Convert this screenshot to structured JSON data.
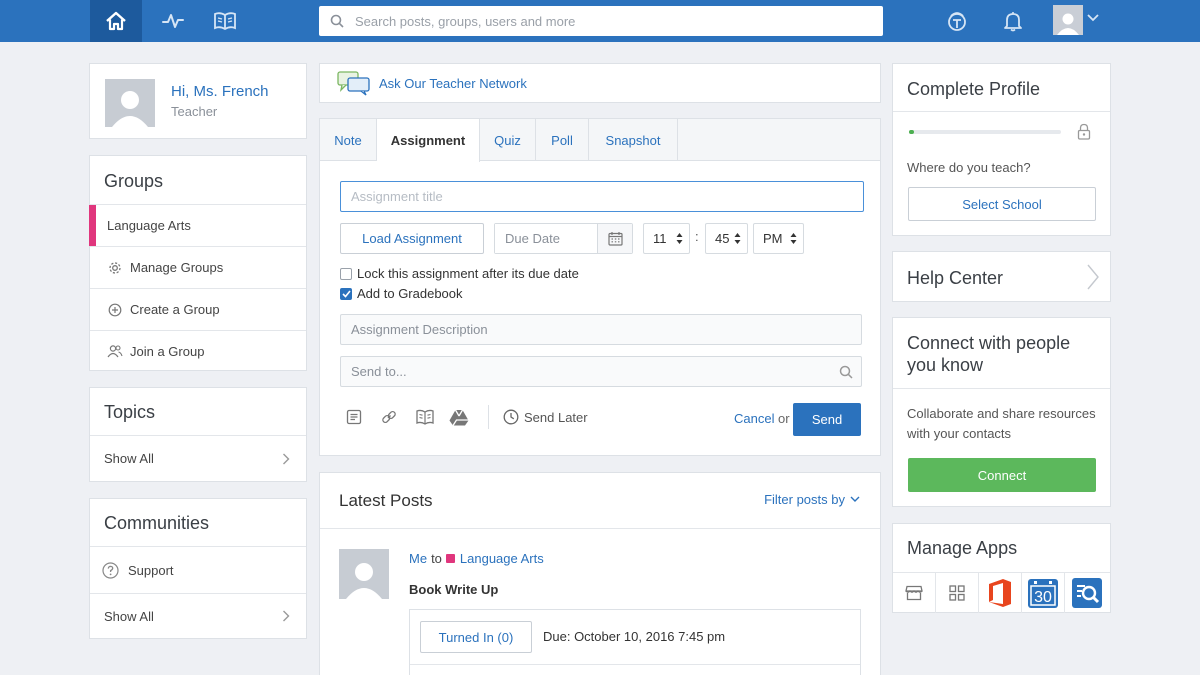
{
  "nav": {
    "items": [
      {
        "icon": "home-icon",
        "active": true
      },
      {
        "icon": "activity-pulse-icon"
      },
      {
        "icon": "backpack-book-icon"
      }
    ],
    "search_placeholder": "Search posts, groups, users and more",
    "right_icons": [
      "backpack-icon",
      "bell-icon",
      "avatar-icon",
      "chevron-down-icon"
    ]
  },
  "profile": {
    "greeting": "Hi, Ms. French",
    "role": "Teacher"
  },
  "groups": {
    "title": "Groups",
    "items": [
      {
        "label": "Language Arts",
        "active": true,
        "color": "#e0367d"
      },
      {
        "label": "Manage Groups",
        "icon": "gear-icon"
      },
      {
        "label": "Create a Group",
        "icon": "plus-circle-icon"
      },
      {
        "label": "Join a Group",
        "icon": "users-icon"
      }
    ]
  },
  "topics": {
    "title": "Topics",
    "show_all": "Show All"
  },
  "communities": {
    "title": "Communities",
    "items": [
      {
        "label": "Support",
        "icon": "question-circle-icon"
      }
    ],
    "show_all": "Show All"
  },
  "ask": {
    "label": "Ask Our Teacher Network"
  },
  "composer": {
    "tabs": [
      "Note",
      "Assignment",
      "Quiz",
      "Poll",
      "Snapshot"
    ],
    "active_tab": "Assignment",
    "title_placeholder": "Assignment title",
    "load_assignment": "Load Assignment",
    "due_placeholder": "Due Date",
    "hour": "11",
    "minute": "45",
    "ampm": "PM",
    "lock_label": "Lock this assignment after its due date",
    "lock_checked": false,
    "gradebook_label": "Add to Gradebook",
    "gradebook_checked": true,
    "description_placeholder": "Assignment Description",
    "sendto_placeholder": "Send to...",
    "send_later": "Send Later",
    "cancel": "Cancel",
    "or": "or",
    "send": "Send"
  },
  "posts": {
    "title": "Latest Posts",
    "filter": "Filter posts by",
    "items": [
      {
        "author": "Me",
        "to": "to",
        "group": "Language Arts",
        "group_color": "#e0367d",
        "title": "Book Write Up",
        "turned_in": "Turned In (0)",
        "due": "Due: October 10, 2016 7:45 pm"
      }
    ]
  },
  "complete_profile": {
    "title": "Complete Profile",
    "progress": 0.03,
    "question": "Where do you teach?",
    "button": "Select School"
  },
  "help_center": {
    "title": "Help Center"
  },
  "connect": {
    "title": "Connect with people you know",
    "blurb": "Collaborate and share resources with your contacts",
    "button": "Connect"
  },
  "apps": {
    "title": "Manage Apps",
    "items": [
      {
        "icon": "store-icon"
      },
      {
        "icon": "grid-icon"
      },
      {
        "icon": "office-app-icon",
        "color": "#e8451e"
      },
      {
        "icon": "calendar-app-icon",
        "label": "30",
        "color": "#2b72bd"
      },
      {
        "icon": "search-app-icon",
        "color": "#2b72bd"
      }
    ]
  },
  "colors": {
    "brand": "#2b72bd",
    "accent": "#e0367d",
    "success": "#5cb85c"
  }
}
